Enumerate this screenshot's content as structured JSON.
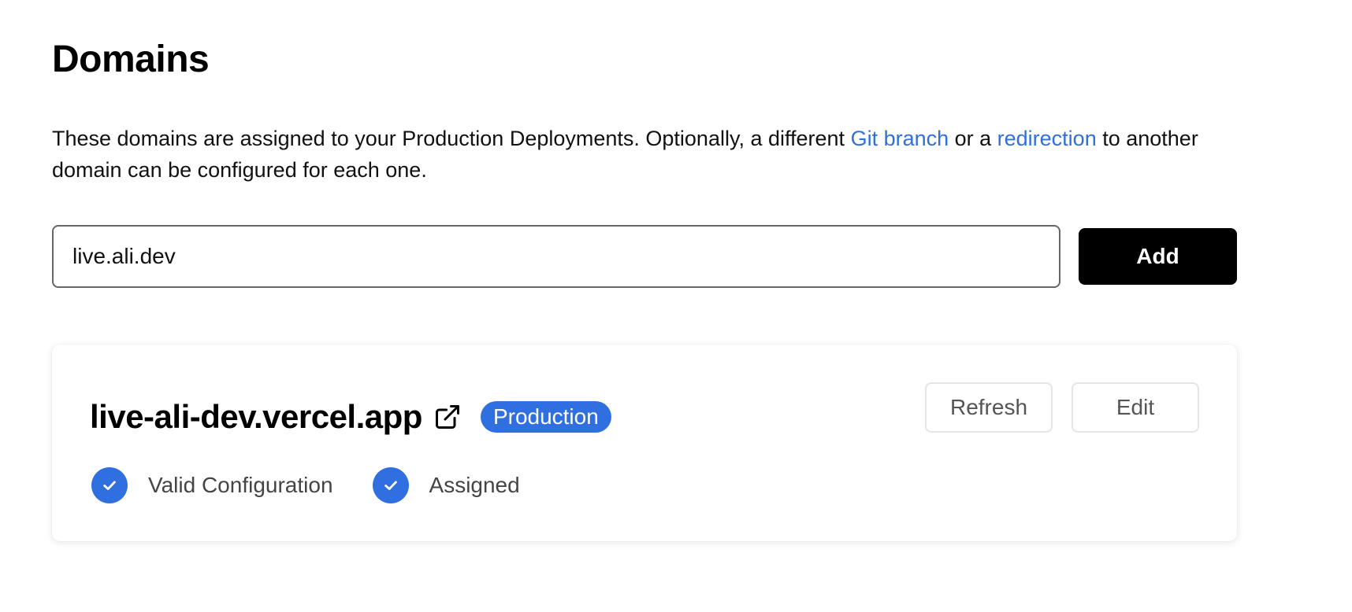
{
  "page": {
    "title": "Domains",
    "description": {
      "part1": "These domains are assigned to your Production Deployments. Optionally, a different ",
      "link1": "Git branch",
      "part2": " or a ",
      "link2": "redirection",
      "part3": " to another domain can be configured for each one."
    }
  },
  "add_form": {
    "input_value": "live.ali.dev",
    "add_label": "Add"
  },
  "domain_card": {
    "domain": "live-ali-dev.vercel.app",
    "badge": "Production",
    "refresh_label": "Refresh",
    "edit_label": "Edit",
    "statuses": [
      {
        "label": "Valid Configuration",
        "icon": "check-circle-icon"
      },
      {
        "label": "Assigned",
        "icon": "check-circle-icon"
      }
    ]
  },
  "colors": {
    "accent": "#2f6fe0",
    "primary_button": "#000000"
  }
}
